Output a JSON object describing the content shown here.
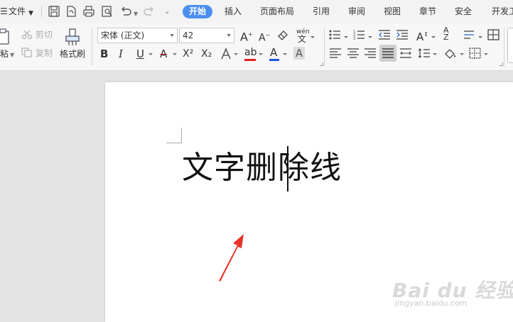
{
  "menubar": {
    "file_label": "文件",
    "tabs": [
      "开始",
      "插入",
      "页面布局",
      "引用",
      "审阅",
      "视图",
      "章节",
      "安全",
      "开发工"
    ],
    "active_tab": "开始"
  },
  "ribbon": {
    "clipboard": {
      "paste_label": "粘",
      "cut_label": "剪切",
      "copy_label": "复制",
      "format_painter_label": "格式刷"
    },
    "font": {
      "font_name": "宋体 (正文)",
      "font_size": "42",
      "pinyin_label": "wén",
      "pinyin_char": "文",
      "bold": "B",
      "italic": "I",
      "underline": "U",
      "strikethrough": "A",
      "superscript": "X²",
      "subscript": "X₂",
      "font_color": "A",
      "highlight": "ab",
      "char_shading": "A"
    },
    "colors": {
      "accent_blue": "#4a8ff0",
      "highlight_red": "#e02020",
      "font_color_blue": "#1a55d6"
    }
  },
  "document": {
    "text_before_caret": "文字删",
    "text_after_caret": "除线"
  },
  "watermark": {
    "main": "Bai du 经验",
    "sub": "jingyan.baidu.com"
  }
}
